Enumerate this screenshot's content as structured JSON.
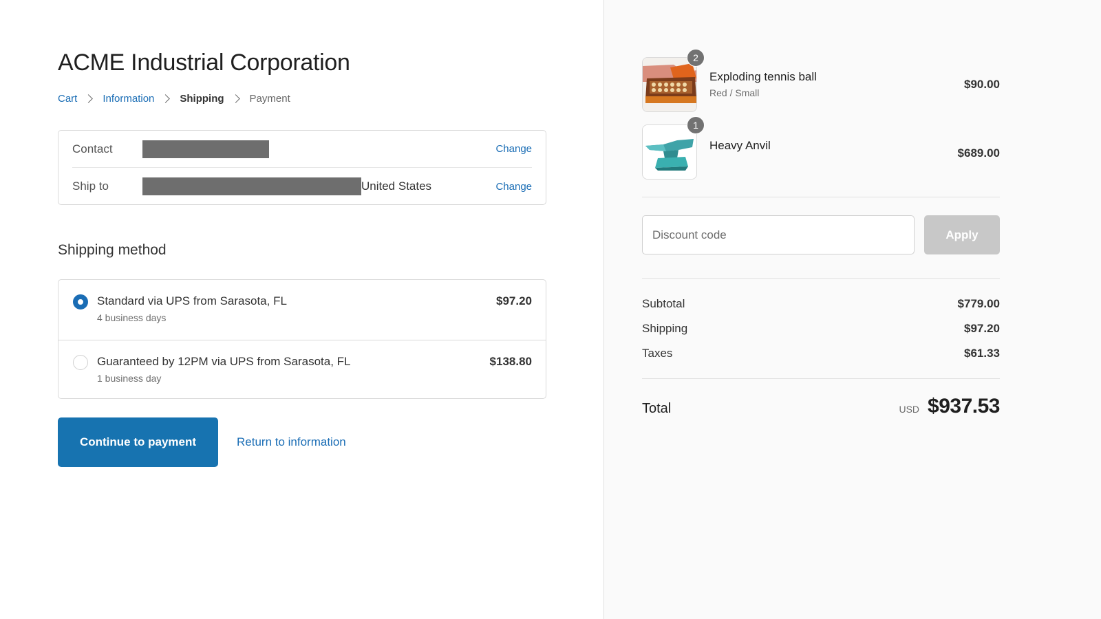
{
  "store": {
    "title": "ACME Industrial Corporation"
  },
  "breadcrumb": [
    {
      "label": "Cart"
    },
    {
      "label": "Information"
    },
    {
      "label": "Shipping"
    },
    {
      "label": "Payment"
    }
  ],
  "review": {
    "contact": {
      "label": "Contact",
      "value": "",
      "change": "Change"
    },
    "ship_to": {
      "label": "Ship to",
      "value": "United States",
      "change": "Change"
    }
  },
  "shipping_method": {
    "title": "Shipping method",
    "options": [
      {
        "name": "Standard via UPS from Sarasota, FL",
        "sub": "4 business days",
        "price": "$97.20",
        "selected": true
      },
      {
        "name": "Guaranteed by 12PM via UPS from Sarasota, FL",
        "sub": "1 business day",
        "price": "$138.80",
        "selected": false
      }
    ]
  },
  "actions": {
    "continue": "Continue to payment",
    "return": "Return to information"
  },
  "order": {
    "items": [
      {
        "qty": "2",
        "name": "Exploding tennis ball",
        "variant": "Red / Small",
        "price": "$90.00",
        "icon": "tennis-ball-box-image"
      },
      {
        "qty": "1",
        "name": "Heavy Anvil",
        "variant": "",
        "price": "$689.00",
        "icon": "anvil-image"
      }
    ],
    "discount": {
      "placeholder": "Discount code",
      "apply": "Apply"
    },
    "summary": {
      "subtotal_label": "Subtotal",
      "subtotal": "$779.00",
      "shipping_label": "Shipping",
      "shipping": "$97.20",
      "taxes_label": "Taxes",
      "taxes": "$61.33"
    },
    "total": {
      "label": "Total",
      "currency": "USD",
      "amount": "$937.53"
    }
  },
  "colors": {
    "accent": "#1773b0",
    "link": "#1a6db5",
    "apply_disabled": "#c8c8c8"
  }
}
